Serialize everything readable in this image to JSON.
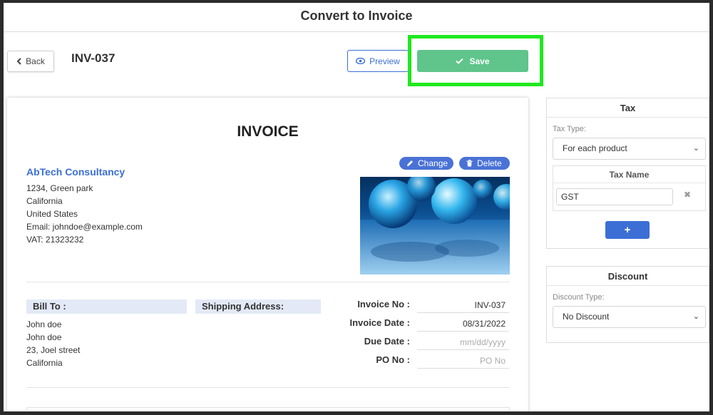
{
  "header": {
    "title": "Convert to Invoice"
  },
  "toolbar": {
    "back_label": "Back",
    "invoice_id": "INV-037",
    "preview_label": "Preview",
    "save_label": "Save"
  },
  "invoice": {
    "title": "INVOICE",
    "company": {
      "name": "AbTech Consultancy",
      "lines": [
        "1234, Green park",
        "California",
        "United States",
        "Email: johndoe@example.com",
        "VAT: 21323232"
      ]
    },
    "logo_actions": {
      "change_label": "Change",
      "delete_label": "Delete"
    },
    "bill_to": {
      "label": "Bill To :",
      "lines": [
        "John doe",
        "John doe",
        "23, Joel street",
        "California"
      ]
    },
    "shipping": {
      "label": "Shipping Address:"
    },
    "meta": {
      "invoice_no_label": "Invoice No :",
      "invoice_no_value": "INV-037",
      "invoice_date_label": "Invoice Date :",
      "invoice_date_value": "08/31/2022",
      "due_date_label": "Due Date :",
      "due_date_placeholder": "mm/dd/yyyy",
      "po_no_label": "PO No :",
      "po_no_placeholder": "PO No"
    }
  },
  "tax_panel": {
    "title": "Tax",
    "type_label": "Tax Type:",
    "type_value": "For each product",
    "name_header": "Tax Name",
    "name_value": "GST",
    "add_label": "+"
  },
  "discount_panel": {
    "title": "Discount",
    "type_label": "Discount Type:",
    "type_value": "No Discount"
  },
  "colors": {
    "accent": "#3b6fd6",
    "save_green": "#5fc58a",
    "highlight": "#1fe81f",
    "label_bg": "#e3e9f6"
  }
}
